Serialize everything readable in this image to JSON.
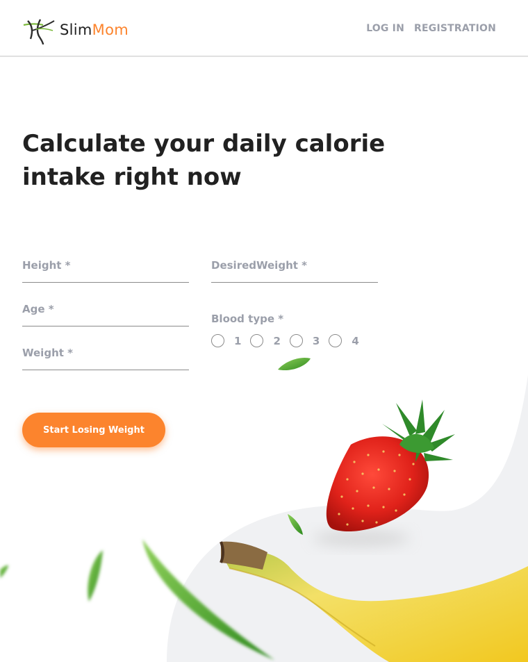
{
  "header": {
    "logo_part1": "Slim",
    "logo_part2": "Mom",
    "nav": [
      {
        "label": "LOG IN"
      },
      {
        "label": "REGISTRATION"
      }
    ]
  },
  "main": {
    "title": "Calculate your daily calorie intake right now",
    "fields": {
      "height_placeholder": "Height *",
      "age_placeholder": "Age *",
      "weight_placeholder": "Weight *",
      "desired_weight_placeholder": "DesiredWeight *"
    },
    "blood_type": {
      "label": "Blood type *",
      "options": [
        "1",
        "2",
        "3",
        "4"
      ]
    },
    "submit_label": "Start Losing Weight"
  },
  "colors": {
    "accent": "#fc842d",
    "text_dark": "#212121",
    "text_muted": "#9b9faa",
    "background_shape": "#f0f1f3"
  },
  "icons": [
    "logo-mark-icon",
    "strawberry-image",
    "banana-image",
    "leaf-icon"
  ]
}
